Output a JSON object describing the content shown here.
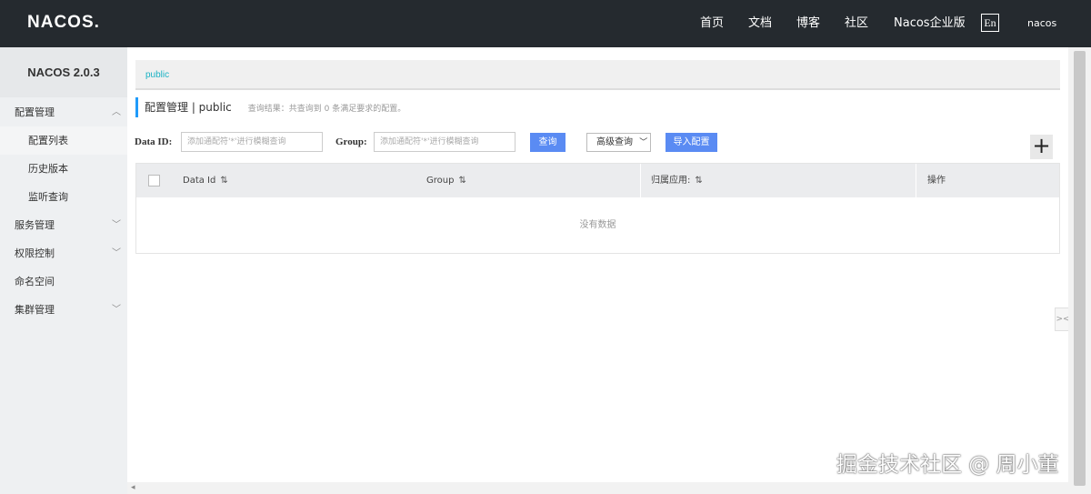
{
  "header": {
    "logo": "NACOS.",
    "nav": [
      "首页",
      "文档",
      "博客",
      "社区",
      "Nacos企业版"
    ],
    "lang": "En",
    "user": "nacos"
  },
  "sidebar": {
    "title": "NACOS 2.0.3",
    "items": [
      {
        "label": "配置管理",
        "expanded": true
      },
      {
        "label": "配置列表"
      },
      {
        "label": "历史版本"
      },
      {
        "label": "监听查询"
      },
      {
        "label": "服务管理"
      },
      {
        "label": "权限控制"
      },
      {
        "label": "命名空间"
      },
      {
        "label": "集群管理"
      }
    ]
  },
  "main": {
    "namespace": "public",
    "title": "配置管理 | public",
    "result_text": "查询结果：共查询到 0 条满足要求的配置。",
    "filters": {
      "data_id_label": "Data ID:",
      "data_id_placeholder": "添加通配符'*'进行模糊查询",
      "group_label": "Group:",
      "group_placeholder": "添加通配符'*'进行模糊查询",
      "query_button": "查询",
      "advanced_query": "高级查询",
      "import_button": "导入配置",
      "add_button": "+"
    },
    "table": {
      "columns": [
        "Data Id",
        "Group",
        "归属应用:",
        "操作"
      ],
      "empty": "没有数据"
    }
  },
  "watermark": "掘金技术社区 @ 周小董",
  "colors": {
    "topbar": "#252a2f",
    "primary": "#5a8bf3",
    "namespace_link": "#1ab2c4",
    "accent_bar": "#209bfa"
  }
}
